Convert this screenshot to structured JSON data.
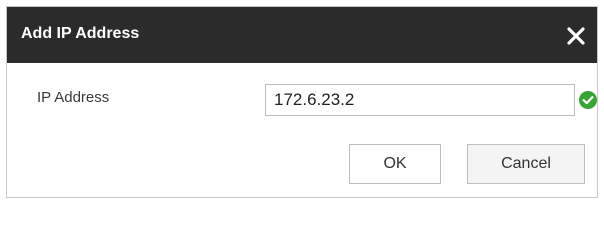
{
  "dialog": {
    "title": "Add IP Address",
    "close_icon": "close-icon"
  },
  "form": {
    "ip_label": "IP Address",
    "ip_value": "172.6.23.2",
    "valid_icon": "check-circle-icon",
    "valid_color": "#3aa335"
  },
  "buttons": {
    "ok_label": "OK",
    "cancel_label": "Cancel"
  },
  "colors": {
    "titlebar": "#2b2b2b",
    "title_text": "#ffffff"
  }
}
